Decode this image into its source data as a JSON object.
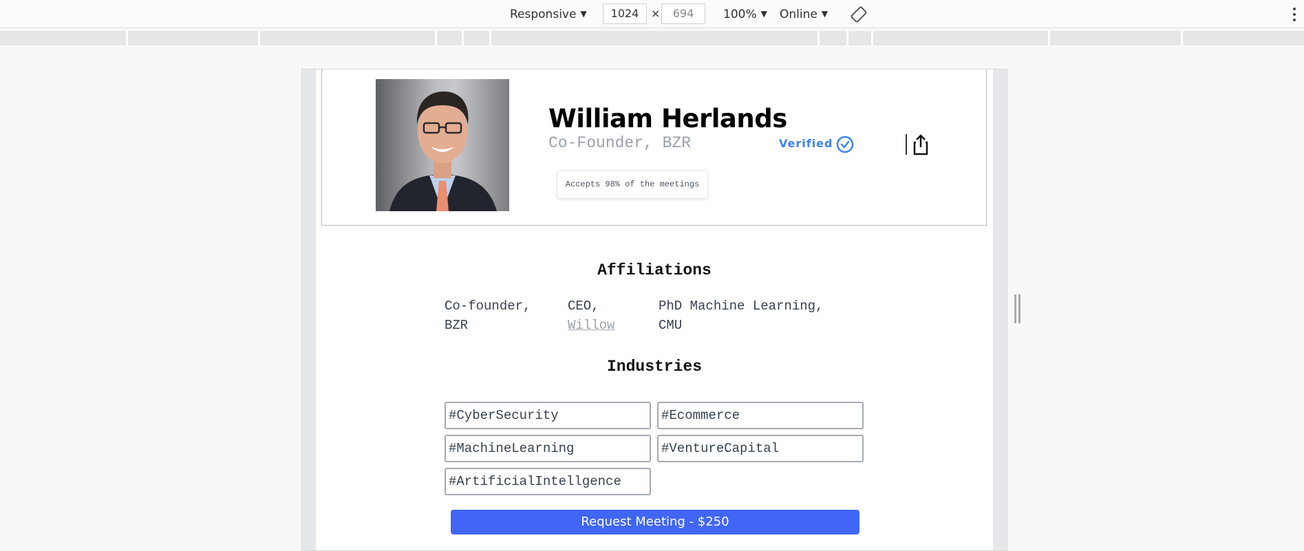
{
  "devtools": {
    "device_mode": "Responsive",
    "width": "1024",
    "height": "694",
    "times": "×",
    "zoom": "100%",
    "network": "Online",
    "caret": "▼"
  },
  "profile": {
    "name": "William Herlands",
    "role": "Co-Founder, BZR",
    "verified_label": "Verified",
    "tooltip": "Accepts 98% of the meetings"
  },
  "affiliations": {
    "title": "Affiliations",
    "items": [
      {
        "line1": "Co-founder,",
        "line2": "BZR"
      },
      {
        "line1": "CEO,",
        "line2": "Willow"
      },
      {
        "line1": "PhD Machine Learning,",
        "line2": "CMU"
      }
    ]
  },
  "industries": {
    "title": "Industries",
    "tags": [
      "#CyberSecurity",
      "#Ecommerce",
      "#MachineLearning",
      "#VentureCapital",
      "#ArtificialIntellgence"
    ]
  },
  "cta": {
    "label": "Request Meeting - $250"
  },
  "colors": {
    "accent": "#4166f5",
    "verified": "#3b82f6"
  },
  "icons": [
    "rotate-icon",
    "more-vert-icon",
    "verified-check-icon",
    "share-icon"
  ]
}
